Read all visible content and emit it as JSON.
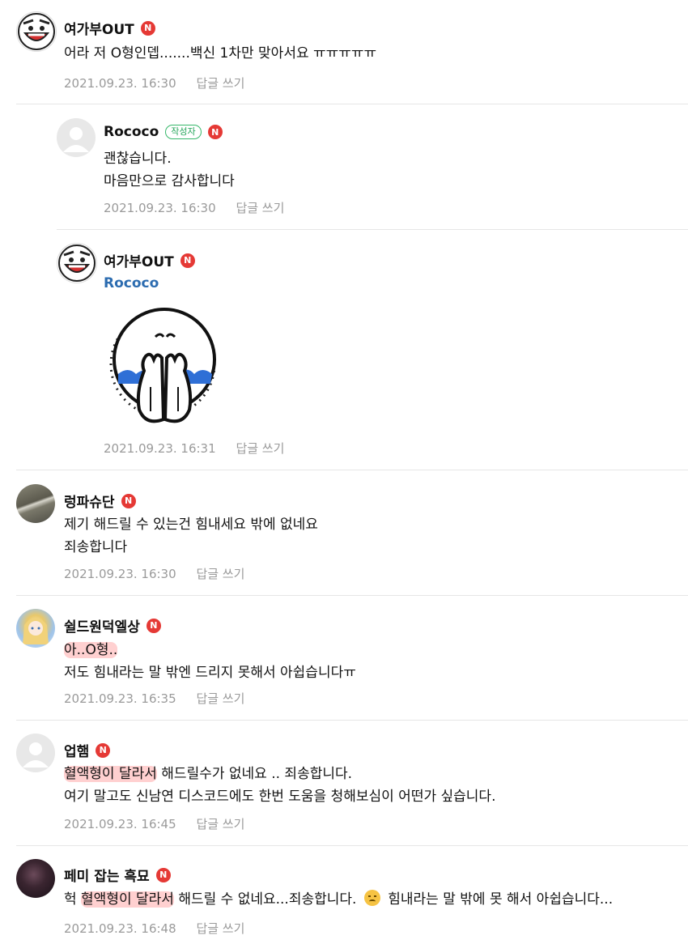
{
  "comments": [
    {
      "nickname": "여가부OUT",
      "lines": [
        "어라 저 O형인뎁.......백신 1차만 맞아서요 ㅠㅠㅠㅠㅠ"
      ],
      "date": "2021.09.23. 16:30",
      "reply_label": "답글 쓰기",
      "avatar": "cartoon-face-icon"
    },
    {
      "nickname": "Rococo",
      "author_badge": "작성자",
      "lines": [
        "괜찮습니다.",
        "마음만으로 감사합니다"
      ],
      "date": "2021.09.23. 16:30",
      "reply_label": "답글 쓰기",
      "avatar": "default-user-icon"
    },
    {
      "nickname": "여가부OUT",
      "mention": "Rococo",
      "sticker": "crying-face-sticker",
      "date": "2021.09.23. 16:31",
      "reply_label": "답글 쓰기",
      "avatar": "cartoon-face-icon"
    },
    {
      "nickname": "렁파슈단",
      "lines": [
        "제기 해드릴 수 있는건 힘내세요 밖에 없네요",
        "죄송합니다"
      ],
      "date": "2021.09.23. 16:30",
      "reply_label": "답글 쓰기",
      "avatar": "photo-avatar"
    },
    {
      "nickname": "쉴드원덕엘상",
      "lines": [
        "아..O형..",
        "저도 힘내라는 말 밖엔 드리지 못해서 아쉽습니다ㅠ"
      ],
      "date": "2021.09.23. 16:35",
      "reply_label": "답글 쓰기",
      "avatar": "anime-avatar"
    },
    {
      "nickname": "업햄",
      "line1_highlight": "혈액형이 달라서",
      "line1_rest": " 해드릴수가 없네요 .. 죄송합니다.",
      "line2": "여기 말고도 신남연 디스코드에도 한번 도움을 청해보심이 어떤가 싶습니다.",
      "date": "2021.09.23. 16:45",
      "reply_label": "답글 쓰기",
      "avatar": "default-user-icon"
    },
    {
      "nickname": "페미 잡는 흑묘",
      "line_pre": "헉 ",
      "line_highlight": "혈액형이 달라서",
      "line_mid": " 해드릴 수 없네요...죄송합니다. ",
      "line_post": " 힘내라는 말 밖에 못 해서 아쉽습니다...",
      "date": "2021.09.23. 16:48",
      "reply_label": "답글 쓰기",
      "avatar": "dark-photo-avatar"
    }
  ],
  "badge_letter": "N",
  "colors": {
    "new_badge": "#e53935",
    "author_badge": "#26a65b",
    "mention": "#2c6cb0",
    "meta": "#9a9a9a",
    "highlight": "#ff9696"
  }
}
